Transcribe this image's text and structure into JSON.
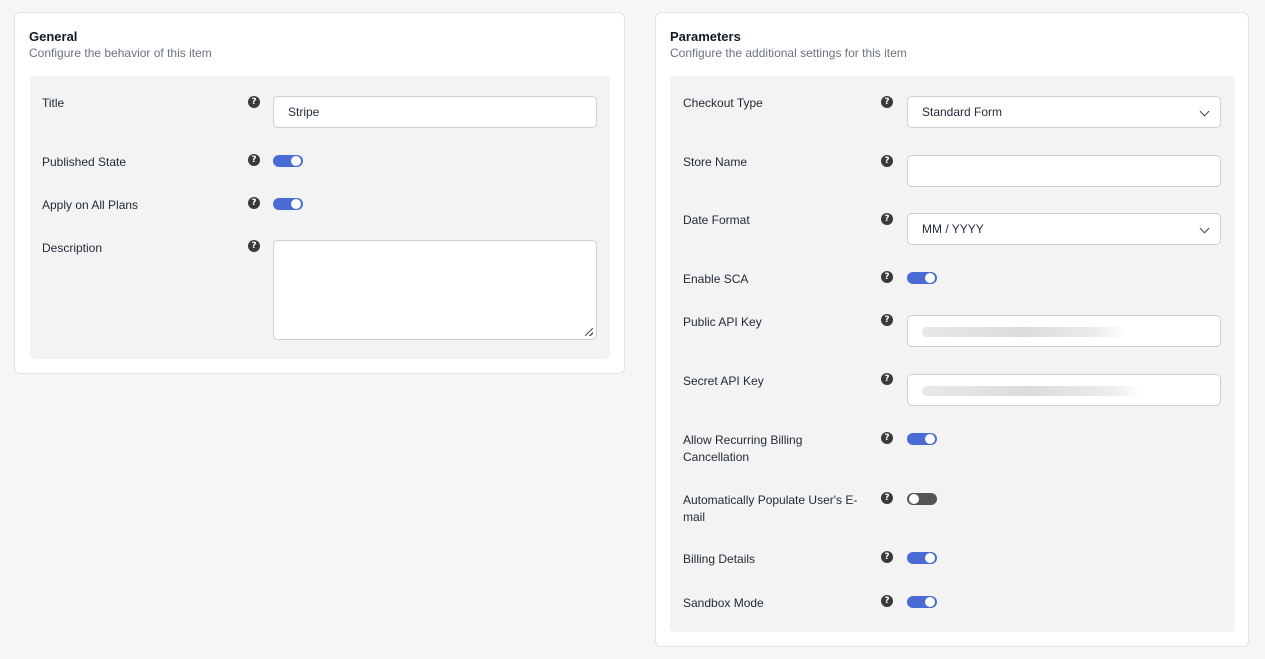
{
  "general": {
    "title": "General",
    "subtitle": "Configure the behavior of this item",
    "fields": {
      "title_label": "Title",
      "title_value": "Stripe",
      "published_label": "Published State",
      "published_on": true,
      "apply_all_label": "Apply on All Plans",
      "apply_all_on": true,
      "description_label": "Description",
      "description_value": ""
    }
  },
  "parameters": {
    "title": "Parameters",
    "subtitle": "Configure the additional settings for this item",
    "fields": {
      "checkout_type_label": "Checkout Type",
      "checkout_type_value": "Standard Form",
      "store_name_label": "Store Name",
      "store_name_value": "",
      "date_format_label": "Date Format",
      "date_format_value": "MM / YYYY",
      "enable_sca_label": "Enable SCA",
      "enable_sca_on": true,
      "public_key_label": "Public API Key",
      "secret_key_label": "Secret API Key",
      "allow_cancel_label_1": "Allow Recurring Billing",
      "allow_cancel_label_2": "Cancellation",
      "allow_cancel_on": true,
      "auto_email_label_1": "Automatically Populate User's E-",
      "auto_email_label_2": "mail",
      "auto_email_on": false,
      "billing_details_label": "Billing Details",
      "billing_details_on": true,
      "sandbox_label": "Sandbox Mode",
      "sandbox_on": true
    }
  },
  "help_glyph": "?",
  "icons": {
    "help": "question-circle-icon",
    "chevron": "chevron-down-icon"
  },
  "colors": {
    "toggle_on": "#4a6bd6",
    "toggle_off": "#555555"
  }
}
